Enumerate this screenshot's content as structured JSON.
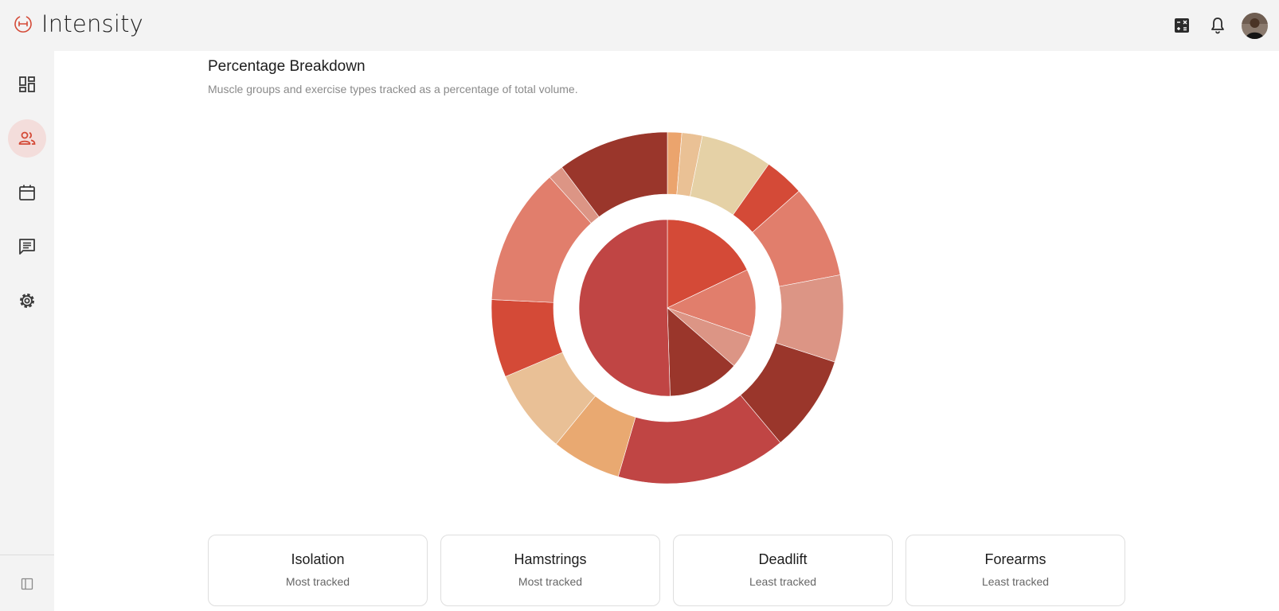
{
  "app": {
    "name": "Intensity"
  },
  "header": {
    "icons": [
      "calculator-icon",
      "bell-icon",
      "avatar"
    ]
  },
  "sidebar": {
    "items": [
      {
        "icon": "dashboard-icon",
        "active": false
      },
      {
        "icon": "users-icon",
        "active": true
      },
      {
        "icon": "calendar-icon",
        "active": false
      },
      {
        "icon": "chat-icon",
        "active": false
      },
      {
        "icon": "settings-icon",
        "active": false
      }
    ],
    "toggle_icon": "sidebar-toggle-icon"
  },
  "section": {
    "title": "Percentage Breakdown",
    "subtitle": "Muscle groups and exercise types tracked as a percentage of total volume."
  },
  "chart_data": {
    "type": "pie",
    "title": "",
    "inner": {
      "values": [
        17.9,
        12.4,
        6.1,
        13.1,
        50.5
      ],
      "colors": [
        "#d44a37",
        "#e17e6c",
        "#dc9585",
        "#9a362b",
        "#c04544"
      ]
    },
    "outer": {
      "values": [
        1.4,
        2.0,
        7.0,
        3.9,
        9.1,
        8.5,
        9.5,
        16.6,
        6.8,
        8.2,
        7.6,
        13.4,
        1.5,
        10.9
      ],
      "colors": [
        "#eba46d",
        "#eac195",
        "#e5d1a6",
        "#d44a37",
        "#e17e6c",
        "#dc9585",
        "#9a362b",
        "#c04544",
        "#e9a971",
        "#e9c096",
        "#d44a37",
        "#e17e6c",
        "#dc9585",
        "#9a362b"
      ]
    }
  },
  "cards": [
    {
      "title": "Isolation",
      "subtitle": "Most tracked"
    },
    {
      "title": "Hamstrings",
      "subtitle": "Most tracked"
    },
    {
      "title": "Deadlift",
      "subtitle": "Least tracked"
    },
    {
      "title": "Forearms",
      "subtitle": "Least tracked"
    }
  ],
  "colors": {
    "accent": "#d44a37",
    "active_bg": "#f3dddb"
  }
}
